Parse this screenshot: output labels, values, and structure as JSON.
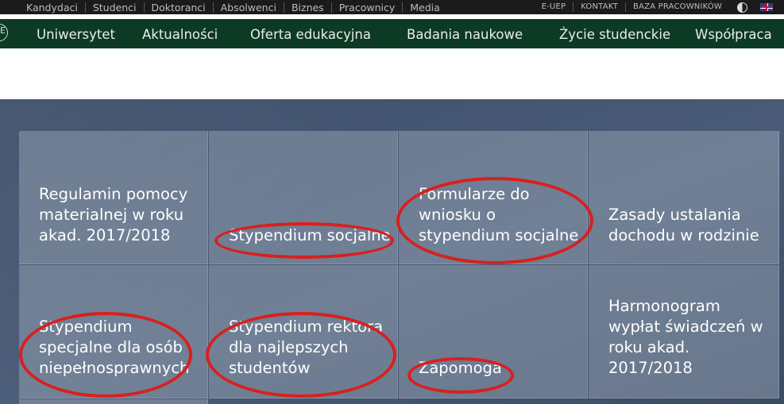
{
  "top_links": [
    "Kandydaci",
    "Studenci",
    "Doktoranci",
    "Absolwenci",
    "Biznes",
    "Pracownicy",
    "Media"
  ],
  "top_right": {
    "e_uep": "E-UEP",
    "kontakt": "KONTAKT",
    "baza": "BAZA PRACOWNIKÓW",
    "contrast_icon": "contrast-icon",
    "language_icon": "uk-flag-icon"
  },
  "main_nav": [
    "Uniwersytet",
    "Aktualności",
    "Oferta edukacyjna",
    "Badania naukowe",
    "Życie studenckie",
    "Współpraca"
  ],
  "tiles": [
    {
      "lines": [
        "Regulamin pomocy",
        "materialnej w roku",
        "akad. 2017/2018"
      ]
    },
    {
      "lines": [
        "Stypendium socjalne"
      ]
    },
    {
      "lines": [
        "Formularze do",
        "wniosku o",
        "stypendium socjalne"
      ]
    },
    {
      "lines": [
        "Zasady ustalania",
        "dochodu w rodzinie"
      ]
    },
    {
      "lines": [
        "Stypendium",
        "specjalne dla osób",
        "niepełnosprawnych"
      ]
    },
    {
      "lines": [
        "Stypendium rektora",
        "dla najlepszych",
        "studentów"
      ]
    },
    {
      "lines": [
        "Zapomoga"
      ]
    },
    {
      "lines": [
        "Harmonogram",
        "wypłat świadczeń w",
        "roku akad.",
        "2017/2018"
      ]
    }
  ],
  "colors": {
    "nav_bg": "#0d3a24",
    "topbar_bg": "#1b1b1b",
    "highlight_ring": "#d8201e"
  }
}
